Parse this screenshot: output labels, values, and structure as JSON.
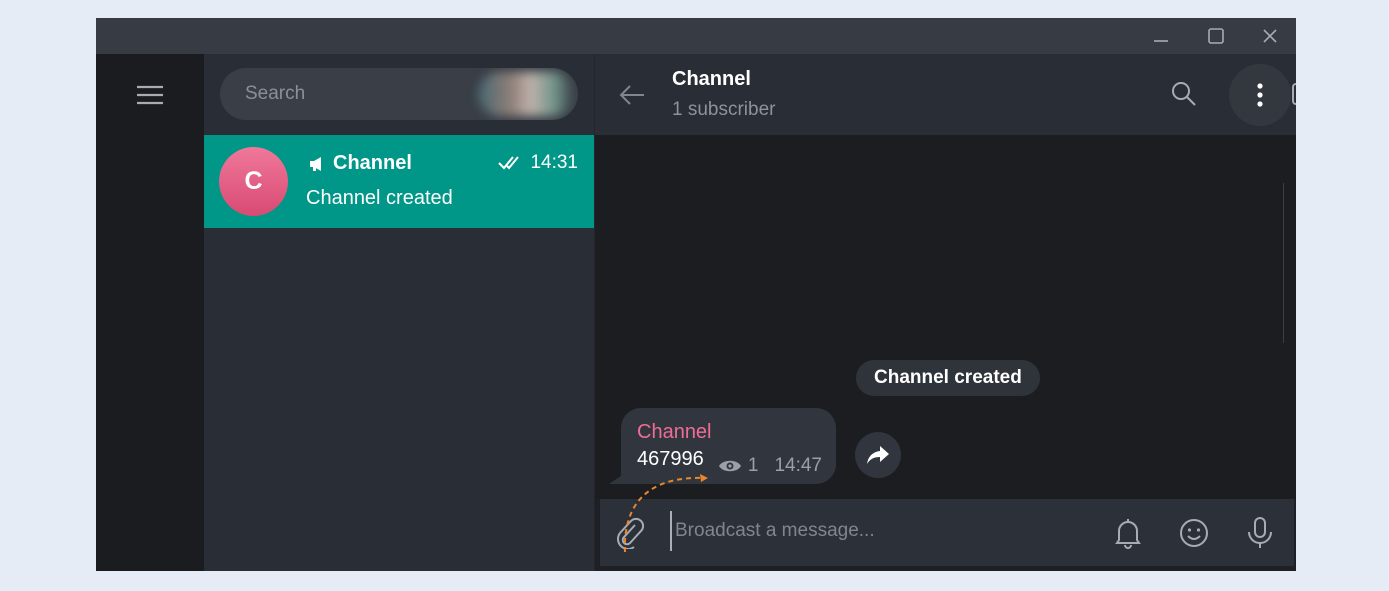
{
  "sidebar": {
    "search_placeholder": "Search"
  },
  "chat_list": {
    "items": [
      {
        "avatar_letter": "C",
        "name": "Channel",
        "time": "14:31",
        "preview": "Channel created"
      }
    ]
  },
  "header": {
    "title": "Channel",
    "subtitle": "1 subscriber"
  },
  "messages": {
    "service_text": "Channel created",
    "post": {
      "author": "Channel",
      "text": "467996",
      "views": "1",
      "time": "14:47"
    }
  },
  "composer": {
    "placeholder": "Broadcast a message..."
  },
  "colors": {
    "accent": "#009688",
    "author": "#ef6d95",
    "annotation_arrow": "#e8872c"
  }
}
